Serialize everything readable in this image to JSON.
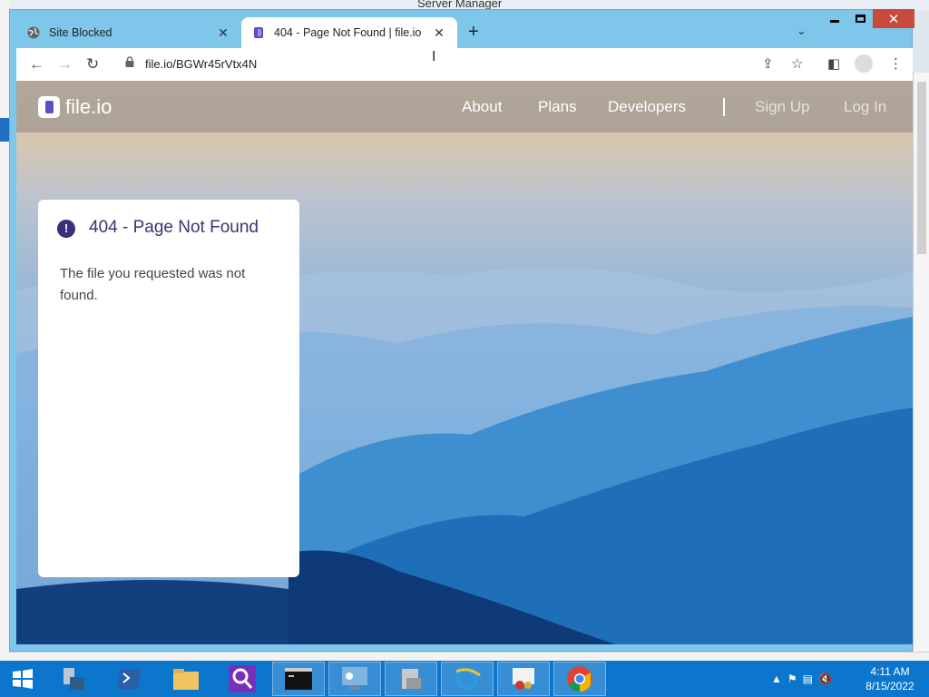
{
  "background_window": {
    "title": "Server Manager"
  },
  "browser": {
    "tabs": [
      {
        "title": "Site Blocked",
        "favicon": "globe-icon",
        "active": false
      },
      {
        "title": "404 - Page Not Found | file.io",
        "favicon": "fileio-icon",
        "active": true
      }
    ],
    "new_tab_label": "+",
    "close_glyph": "✕",
    "url": "file.io/BGWr45rVtx4N"
  },
  "site": {
    "logo_text": "file.io",
    "nav": [
      "About",
      "Plans",
      "Developers"
    ],
    "auth": [
      "Sign Up",
      "Log In"
    ]
  },
  "error_card": {
    "icon": "!",
    "title": "404 - Page Not Found",
    "message": "The file you requested was not found."
  },
  "taskbar": {
    "apps": [
      "start",
      "server-manager",
      "powershell",
      "file-explorer",
      "search-tool",
      "command-prompt",
      "control-panel",
      "installer",
      "internet-explorer",
      "certificate-tool",
      "chrome"
    ],
    "clock_time": "4:11 AM",
    "clock_date": "8/15/2022"
  },
  "colors": {
    "accent": "#5b4fc8",
    "title_text": "#3a3570",
    "taskbar": "#0b76cc",
    "window_frame": "#7ec6ea"
  }
}
